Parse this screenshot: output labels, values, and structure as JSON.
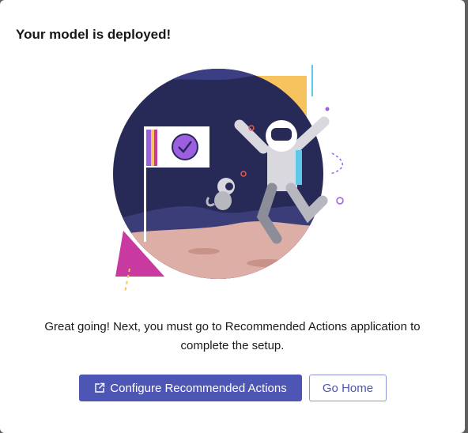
{
  "dialog": {
    "title": "Your model is deployed!",
    "message": "Great going! Next, you must go to Recommended Actions application to complete the setup."
  },
  "illustration": {
    "icon": "astronaut-celebration-illustration"
  },
  "actions": {
    "primary_label": "Configure Recommended Actions",
    "primary_icon": "external-link-icon",
    "secondary_label": "Go Home"
  },
  "colors": {
    "primary": "#4d55b5",
    "title_text": "#16171a",
    "space": "#2a2c5a",
    "ground": "#dcaea5",
    "accent_yellow": "#f7c35f",
    "accent_magenta": "#c93aa0",
    "accent_purple": "#9b5fe0"
  }
}
